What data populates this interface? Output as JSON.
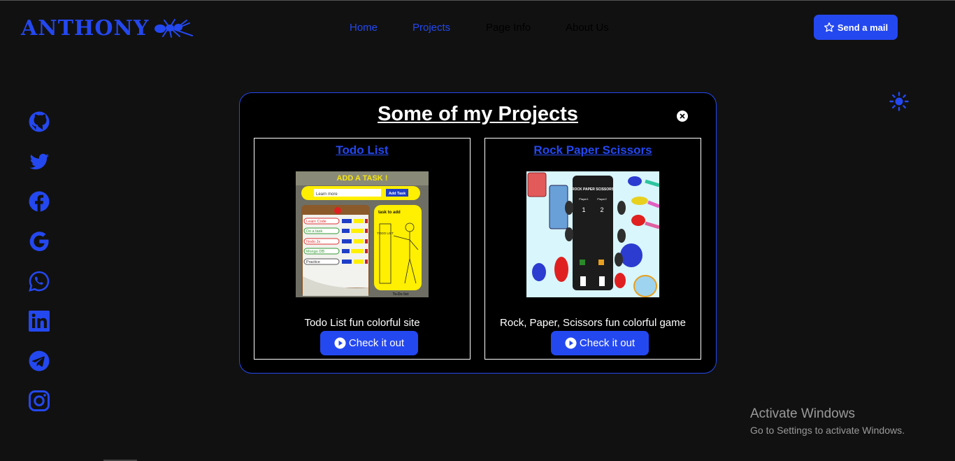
{
  "header": {
    "logo_text": "ANTHONY",
    "nav": [
      {
        "label": "Home"
      },
      {
        "label": "Projects"
      },
      {
        "label": "Page Info"
      },
      {
        "label": "About Us"
      }
    ],
    "mail_button": "Send a mail"
  },
  "socials": [
    "github-icon",
    "twitter-icon",
    "facebook-icon",
    "google-icon",
    "whatsapp-icon",
    "linkedin-icon",
    "telegram-icon",
    "instagram-icon"
  ],
  "modal": {
    "title": "Some of my Projects",
    "projects": [
      {
        "title": "Todo List",
        "description": "Todo List fun colorful site",
        "button": "Check it out",
        "thumb": {
          "header": "ADD A TASK !",
          "input": "Learn more",
          "add_button": "Add Task",
          "tasks": [
            "Learn Code",
            "Do a task",
            "Nodo Js",
            "Mongo DB",
            "Practice"
          ],
          "side_note": "task to add",
          "side_word": "TODO LIST",
          "footer": "To-Do list"
        }
      },
      {
        "title": "Rock Paper Scissors",
        "description": "Rock, Paper, Scissors fun colorful game",
        "button": "Check it out",
        "thumb": {
          "panel_title": "ROCK PAPER SCISSORS",
          "player1": "Player1",
          "player2": "Player2",
          "score1": "1",
          "score2": "2"
        }
      }
    ]
  },
  "watermark": {
    "line1": "Activate Windows",
    "line2": "Go to Settings to activate Windows."
  },
  "colors": {
    "accent": "#2448f0",
    "background": "#111111",
    "modal_bg": "#000000"
  }
}
